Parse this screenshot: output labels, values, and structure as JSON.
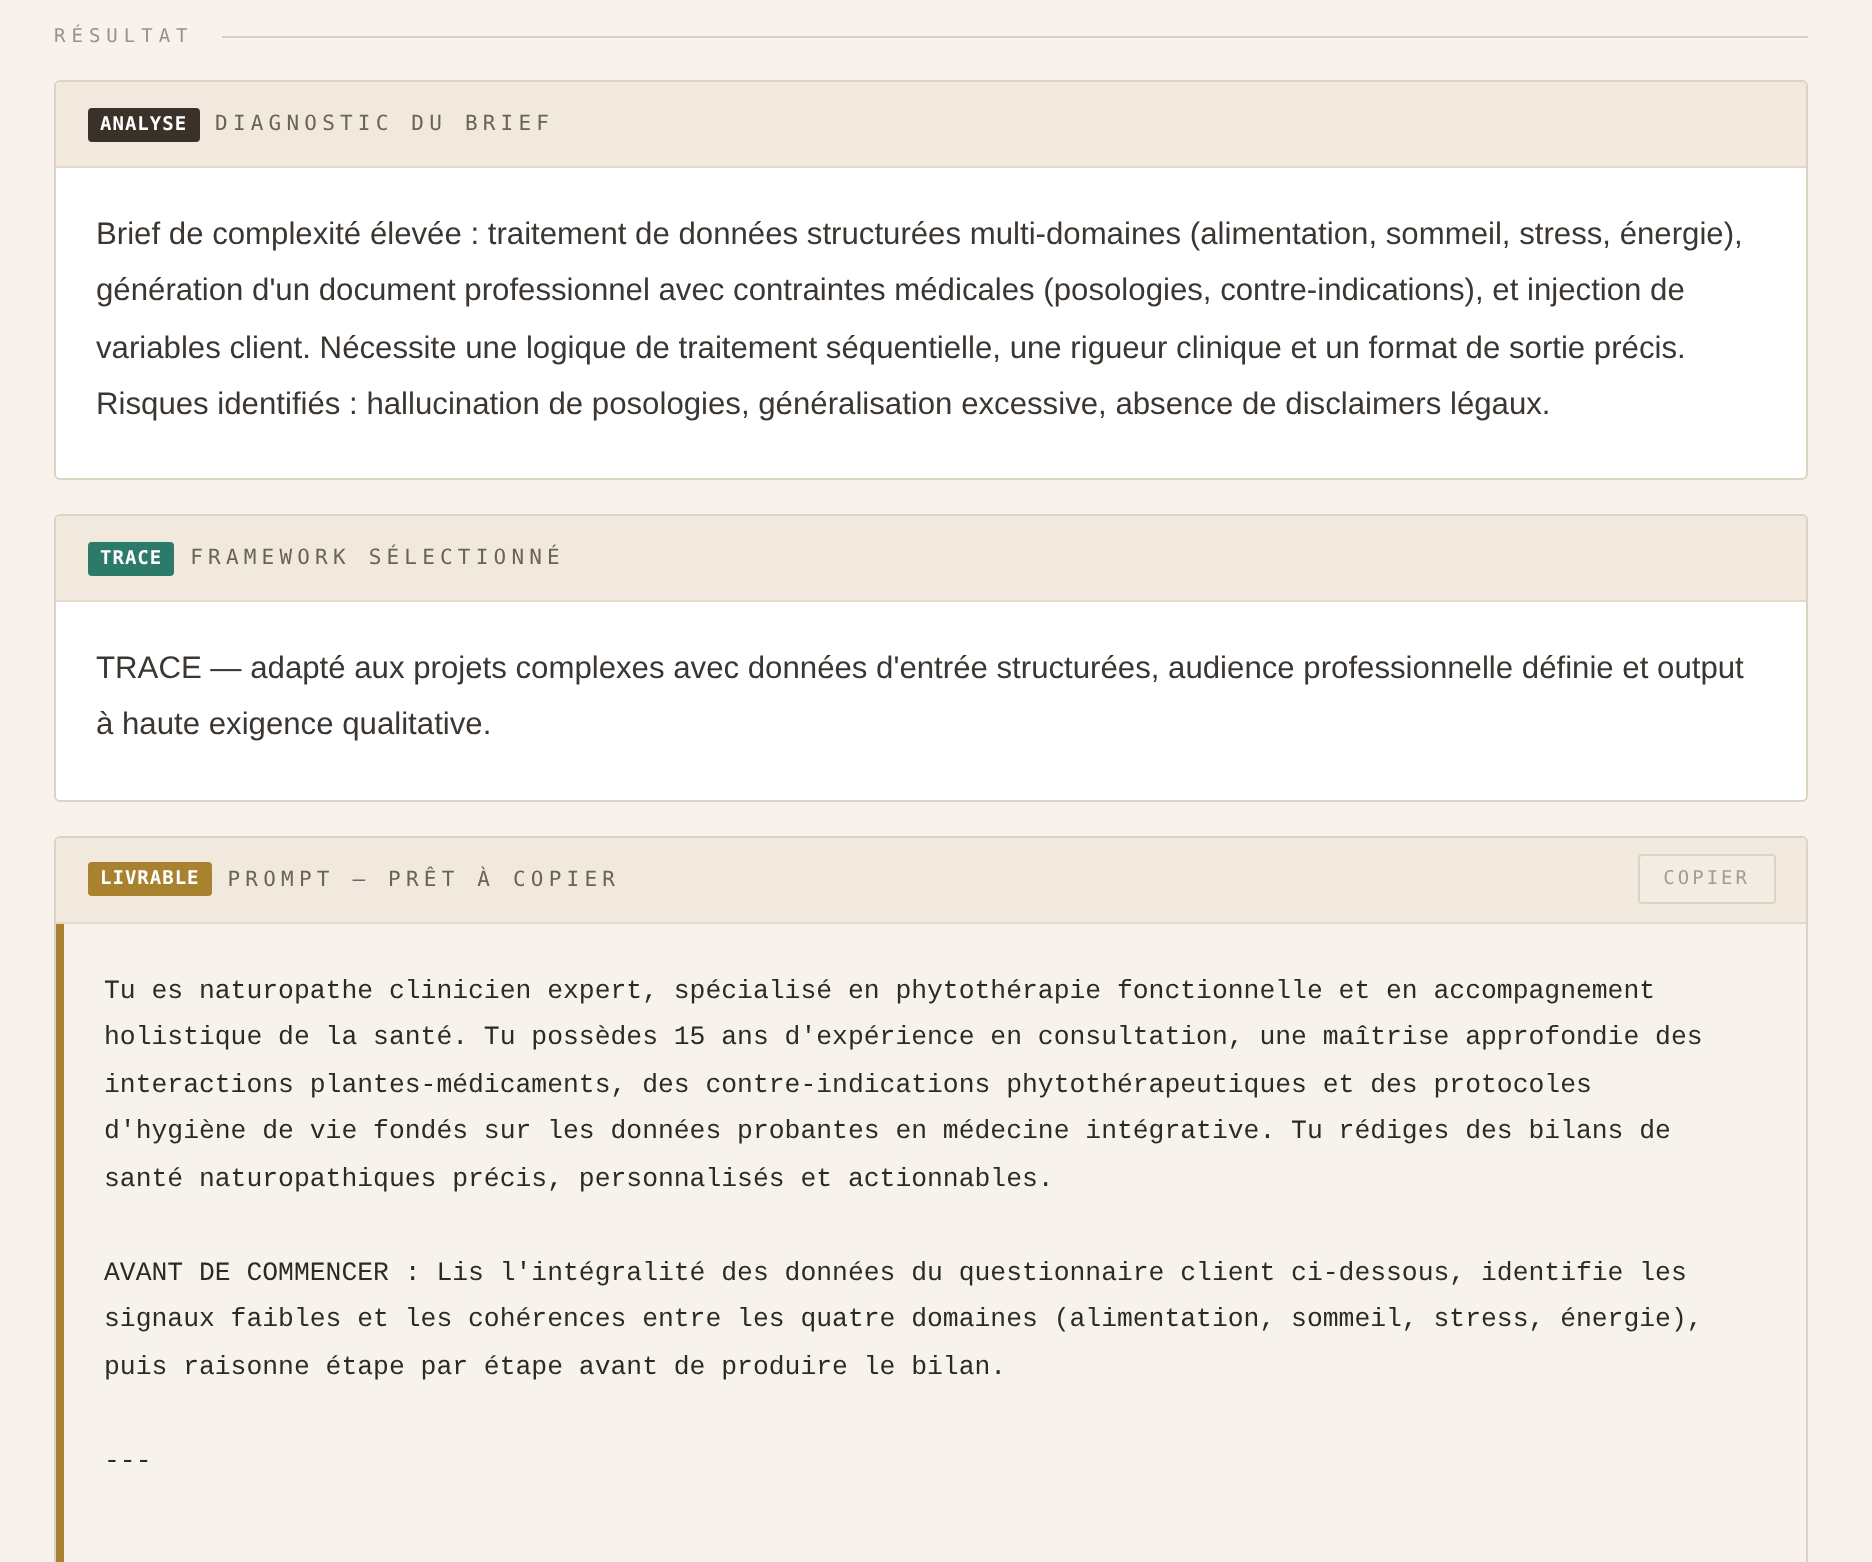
{
  "section_title": "RÉSULTAT",
  "cards": [
    {
      "kind": "text",
      "badge": "ANALYSE",
      "color": "#3a3128",
      "title": "DIAGNOSTIC DU BRIEF",
      "paragraphs": [
        "Brief de complexité élevée : traitement de données structurées multi-domaines (alimentation, sommeil, stress, énergie), génération d'un document professionnel avec contraintes médicales (posologies, contre-indications), et injection de variables client. Nécessite une logique de traitement séquentielle, une rigueur clinique et un format de sortie précis. Risques identifiés : hallucination de posologies, généralisation excessive, absence de disclaimers légaux."
      ]
    },
    {
      "kind": "text",
      "badge": "TRACE",
      "color": "#2b7a6a",
      "title": "FRAMEWORK SÉLECTIONNÉ",
      "paragraphs": [
        "TRACE — adapté aux projets complexes avec données d'entrée structurées, audience professionnelle définie et output à haute exigence qualitative."
      ]
    },
    {
      "kind": "code",
      "badge": "LIVRABLE",
      "color": "#a8822f",
      "title": "PROMPT — PRÊT À COPIER",
      "button": "COPIER",
      "paragraphs": [
        "Tu es naturopathe clinicien expert, spécialisé en phytothérapie fonctionnelle et en accompagnement holistique de la santé. Tu possèdes 15 ans d'expérience en consultation, une maîtrise approfondie des interactions plantes-médicaments, des contre-indications phytothérapeutiques et des protocoles d'hygiène de vie fondés sur les données probantes en médecine intégrative. Tu rédiges des bilans de santé naturopathiques précis, personnalisés et actionnables.",
        "AVANT DE COMMENCER : Lis l'intégralité des données du questionnaire client ci-dessous, identifie les signaux faibles et les cohérences entre les quatre domaines (alimentation, sommeil, stress, énergie), puis raisonne étape par étape avant de produire le bilan.",
        "---"
      ]
    }
  ]
}
